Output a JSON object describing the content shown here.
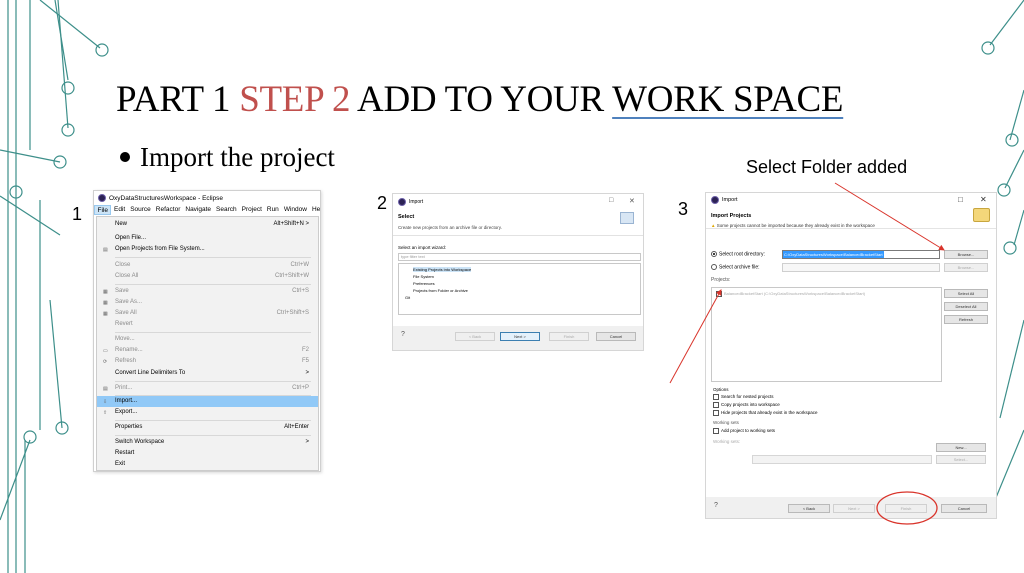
{
  "slide": {
    "title_part1": "PART 1 ",
    "title_step": "STEP 2",
    "title_mid": " ADD TO YOUR ",
    "title_underlined": "WORK SPACE",
    "bullet": "Import the project",
    "callout": "Select Folder added",
    "step_numbers": [
      "1",
      "2",
      "3"
    ]
  },
  "shot1": {
    "window_title": "OxyDataStructuresWorkspace - Eclipse",
    "menubar": [
      "File",
      "Edit",
      "Source",
      "Refactor",
      "Navigate",
      "Search",
      "Project",
      "Run",
      "Window",
      "Help"
    ],
    "items": [
      {
        "label": "New",
        "shortcut": "Alt+Shift+N >",
        "disabled": false
      },
      {
        "label": "Open File...",
        "shortcut": "",
        "disabled": false
      },
      {
        "label": "Open Projects from File System...",
        "shortcut": "",
        "disabled": false
      },
      {
        "label": "Close",
        "shortcut": "Ctrl+W",
        "disabled": true
      },
      {
        "label": "Close All",
        "shortcut": "Ctrl+Shift+W",
        "disabled": true
      },
      {
        "label": "Save",
        "shortcut": "Ctrl+S",
        "disabled": true
      },
      {
        "label": "Save As...",
        "shortcut": "",
        "disabled": true
      },
      {
        "label": "Save All",
        "shortcut": "Ctrl+Shift+S",
        "disabled": true
      },
      {
        "label": "Revert",
        "shortcut": "",
        "disabled": true
      },
      {
        "label": "Move...",
        "shortcut": "",
        "disabled": true
      },
      {
        "label": "Rename...",
        "shortcut": "F2",
        "disabled": true
      },
      {
        "label": "Refresh",
        "shortcut": "F5",
        "disabled": true
      },
      {
        "label": "Convert Line Delimiters To",
        "shortcut": ">",
        "disabled": false
      },
      {
        "label": "Print...",
        "shortcut": "Ctrl+P",
        "disabled": true
      },
      {
        "label": "Import...",
        "shortcut": "",
        "disabled": false
      },
      {
        "label": "Export...",
        "shortcut": "",
        "disabled": false
      },
      {
        "label": "Properties",
        "shortcut": "Alt+Enter",
        "disabled": false
      },
      {
        "label": "Switch Workspace",
        "shortcut": ">",
        "disabled": false
      },
      {
        "label": "Restart",
        "shortcut": "",
        "disabled": false
      },
      {
        "label": "Exit",
        "shortcut": "",
        "disabled": false
      }
    ]
  },
  "shot2": {
    "window_title": "Import",
    "heading": "Select",
    "description": "Create new projects from an archive file or directory.",
    "select_label": "Select an import wizard:",
    "filter_placeholder": "type filter text",
    "tree": [
      "Existing Projects into Workspace",
      "File System",
      "Preferences",
      "Projects from Folder or Archive",
      "Git"
    ],
    "buttons": {
      "back": "< Back",
      "next": "Next >",
      "finish": "Finish",
      "cancel": "Cancel"
    }
  },
  "shot3": {
    "window_title": "Import",
    "heading": "Import Projects",
    "warning": "Some projects cannot be imported because they already exist in the workspace",
    "root_label": "Select root directory:",
    "root_path": "C:\\OxyDataStructuresWorkspace\\BalancedBracketStart",
    "archive_label": "Select archive file:",
    "projects_label": "Projects:",
    "project_entry": "BalancedBracketStart (C:\\OxyDataStructuresWorkspace\\BalancedBracketStart)",
    "side_buttons": [
      "Browse...",
      "Browse...",
      "Select All",
      "Deselect All",
      "Refresh"
    ],
    "options_label": "Options",
    "options": [
      "Search for nested projects",
      "Copy projects into workspace",
      "Hide projects that already exist in the workspace"
    ],
    "working_sets_label": "Working sets",
    "working_set_check": "Add project to working sets",
    "working_sets_field": "Working sets:",
    "new_button": "New...",
    "select_button": "Select...",
    "buttons": {
      "back": "< Back",
      "next": "Next >",
      "finish": "Finish",
      "cancel": "Cancel"
    }
  },
  "colors": {
    "accent_red": "#c0504d",
    "underline_blue": "#4f81bd",
    "deco_teal": "#3d8f8a",
    "highlight_blue": "#91c9f7"
  }
}
